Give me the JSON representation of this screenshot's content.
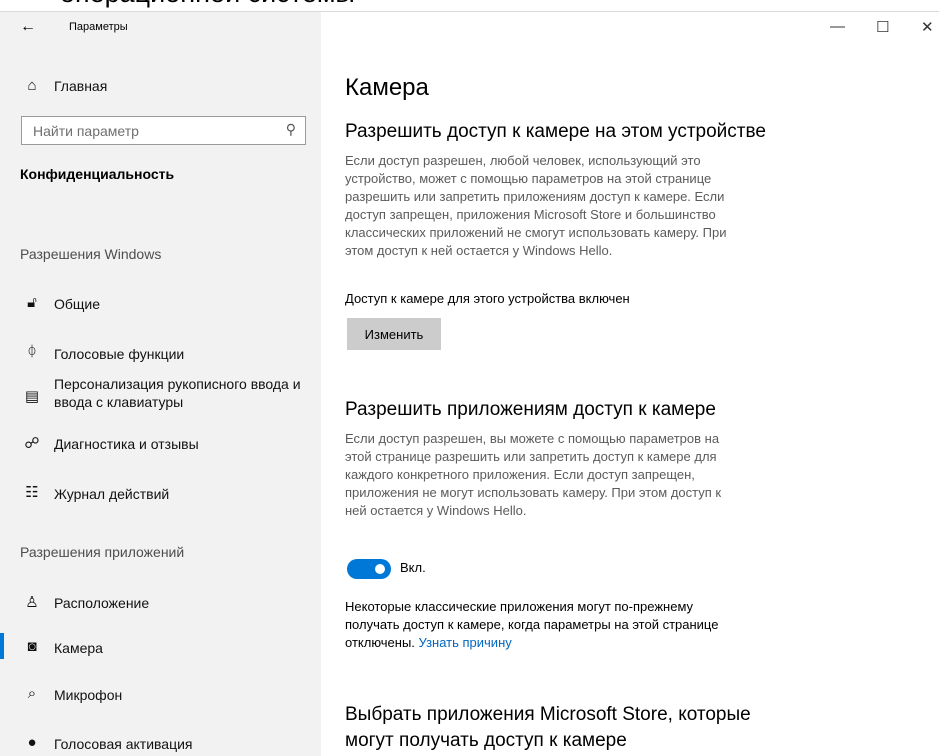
{
  "cut_heading": "операционной системы",
  "window": {
    "app_title": "Параметры",
    "controls": {
      "minimize": "—",
      "maximize": "☐",
      "close": "✕"
    }
  },
  "sidebar": {
    "home": {
      "label": "Главная",
      "icon": "home-icon"
    },
    "search": {
      "placeholder": "Найти параметр",
      "icon": "search-icon"
    },
    "section_title": "Конфиденциальность",
    "windows_permissions": {
      "header": "Разрешения Windows",
      "items": [
        {
          "label": "Общие",
          "icon": "lock-icon"
        },
        {
          "label": "Голосовые функции",
          "icon": "speech-icon"
        },
        {
          "label": "Персонализация рукописного ввода и",
          "label2": "ввода с клавиатуры",
          "icon": "clipboard-icon"
        },
        {
          "label": "Диагностика и отзывы",
          "icon": "feedback-icon"
        },
        {
          "label": "Журнал действий",
          "icon": "timeline-icon"
        }
      ]
    },
    "app_permissions": {
      "header": "Разрешения приложений",
      "items": [
        {
          "label": "Расположение",
          "icon": "location-icon"
        },
        {
          "label": "Камера",
          "icon": "camera-icon",
          "active": true
        },
        {
          "label": "Микрофон",
          "icon": "microphone-icon"
        },
        {
          "label": "Голосовая активация",
          "icon": "mic-filled-icon"
        }
      ]
    }
  },
  "main": {
    "title": "Камера",
    "device_access": {
      "heading": "Разрешить доступ к камере на этом устройстве",
      "description": [
        "Если доступ разрешен, любой человек, использующий это",
        "устройство, может с помощью параметров на этой странице",
        "разрешить или запретить приложениям доступ к камере. Если",
        "доступ запрещен, приложения Microsoft Store и большинство",
        "классических приложений не смогут использовать камеру. При",
        "этом доступ к ней остается у Windows Hello."
      ],
      "status": "Доступ к камере для этого устройства включен",
      "change_button": "Изменить"
    },
    "app_access": {
      "heading": "Разрешить приложениям доступ к камере",
      "description": [
        "Если доступ разрешен, вы можете с помощью параметров на",
        "этой странице разрешить или запретить доступ к камере для",
        "каждого конкретного приложения. Если доступ запрещен,",
        "приложения не могут использовать камеру. При этом доступ к",
        "ней остается у Windows Hello."
      ],
      "toggle_label": "Вкл.",
      "toggle_on": true,
      "note": [
        "Некоторые классические приложения могут по-прежнему",
        "получать доступ к камере, когда параметры на этой странице",
        "отключены."
      ],
      "note_link": "Узнать причину"
    },
    "store_apps": {
      "heading_line1": "Выбрать приложения Microsoft Store, которые",
      "heading_line2": "могут получать доступ к камере"
    }
  },
  "colors": {
    "accent": "#0078d7",
    "link": "#0067c0",
    "sidebar_bg": "#f2f2f2"
  }
}
